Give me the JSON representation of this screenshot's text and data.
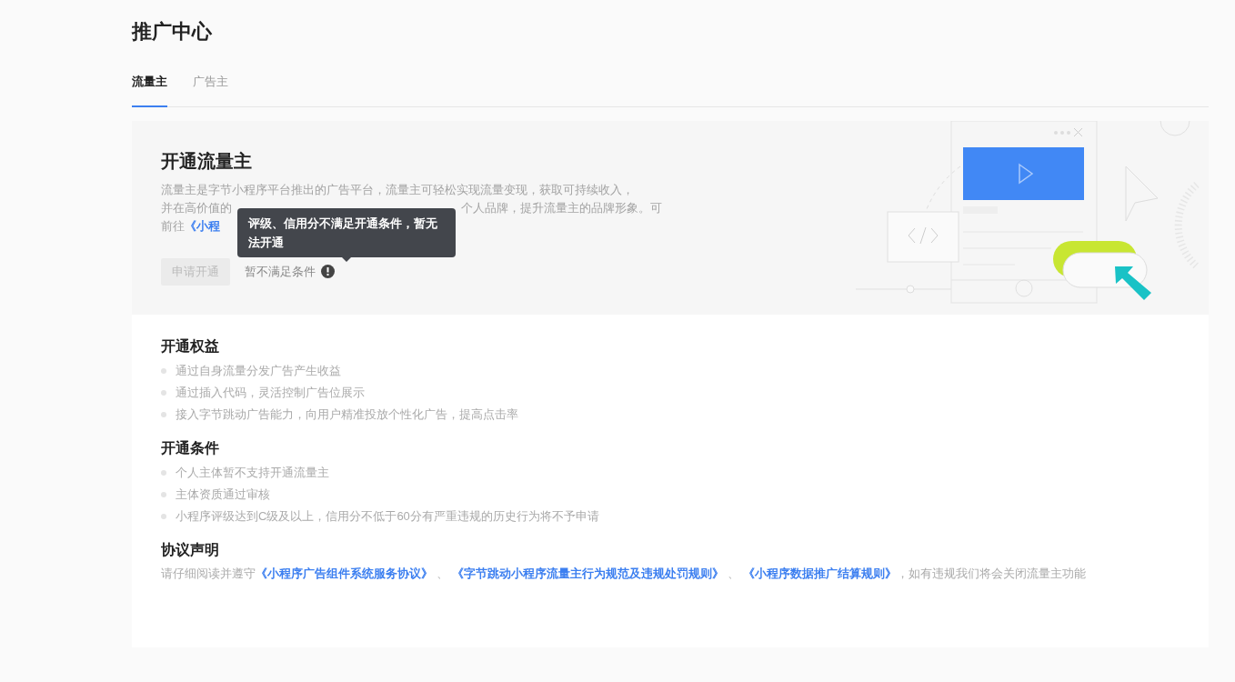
{
  "page_title": "推广中心",
  "tabs": [
    {
      "label": "流量主",
      "selected": true
    },
    {
      "label": "广告主",
      "selected": false
    }
  ],
  "intro": {
    "title": "开通流量主",
    "description_line_1": "流量主是字节小程序平台推出的广告平台，流量主可轻松实现流量变现，获取可持续收入，",
    "description_line_2_start": "并在高价值的",
    "description_line_2_end": "个人品牌，提升流量主的品牌形象。可",
    "description_line_3_start": "前往",
    "description_line_3_link": "《小程",
    "apply_button": {
      "label": "申请开通",
      "disabled": true
    },
    "status": "暂不满足条件",
    "tooltip": "评级、信用分不满足开通条件，暂无法开通"
  },
  "sections": [
    {
      "title": "开通权益",
      "items": [
        "通过自身流量分发广告产生收益",
        "通过插入代码，灵活控制广告位展示",
        "接入字节跳动广告能力，向用户精准投放个性化广告，提高点击率"
      ]
    },
    {
      "title": "开通条件",
      "items": [
        "个人主体暂不支持开通流量主",
        "主体资质通过审核",
        "小程序评级达到C级及以上，信用分不低于60分有严重违规的历史行为将不予申请"
      ]
    }
  ],
  "agreement": {
    "title": "协议声明",
    "prefix": "请仔细阅读并遵守",
    "links": [
      "《小程序广告组件系统服务协议》",
      "《字节跳动小程序流量主行为规范及违规处罚规则》",
      "《小程序数据推广结算规则》"
    ],
    "separator": "、",
    "suffix": "，如有违规我们将会关闭流量主功能"
  }
}
